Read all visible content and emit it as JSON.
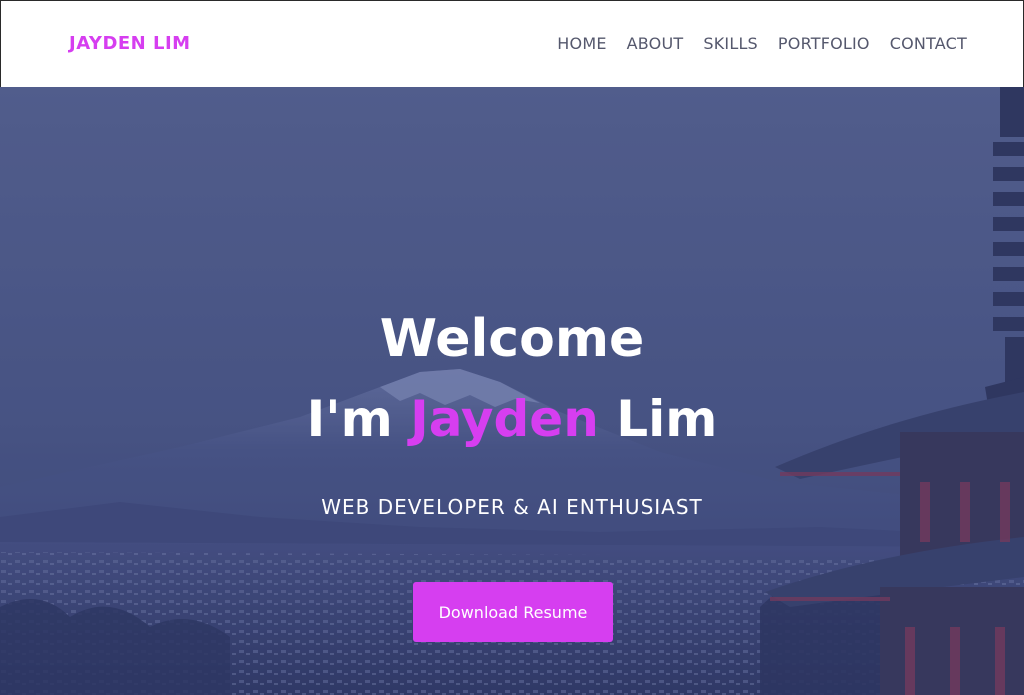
{
  "nav": {
    "brand": "JAYDEN LIM",
    "links": [
      "HOME",
      "ABOUT",
      "SKILLS",
      "PORTFOLIO",
      "CONTACT"
    ]
  },
  "hero": {
    "welcome": "Welcome",
    "intro_prefix": "I'm",
    "first_name": "Jayden",
    "last_name": "Lim",
    "tagline": "WEB DEVELOPER & AI ENTHUSIAST",
    "button_label": "Download Resume"
  },
  "colors": {
    "accent": "#d63ef0",
    "nav_text": "#55586d",
    "hero_overlay": "#4a5688"
  }
}
